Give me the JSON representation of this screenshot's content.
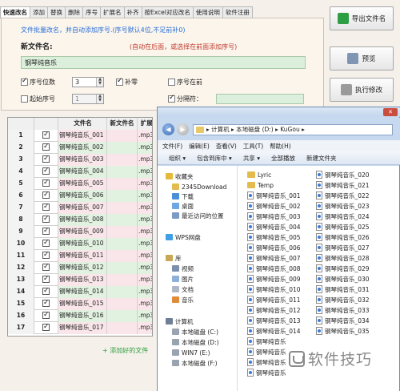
{
  "tabs": [
    "快速改名",
    "添加",
    "替换",
    "删除",
    "序号",
    "扩展名",
    "补齐",
    "按Excel对应改名",
    "使用说明",
    "软件注册"
  ],
  "form": {
    "hint": "文件批量改名，并自动添加序号.(序号默认4位,不足前补0)",
    "new_name_label": "新文件名:",
    "new_name_hint": "(自动在后面，或选择在前面添加序号)",
    "new_name_value": "钢琴纯音乐",
    "seq_digits_label": "序号位数",
    "seq_digits_value": "3",
    "pad_zero_label": "补零",
    "seq_front_label": "序号在前",
    "start_seq_label": "起始序号",
    "start_seq_value": "1",
    "separator_label": "分隔符："
  },
  "buttons": {
    "export": "导出文件名",
    "preview": "预览",
    "execute": "执行修改"
  },
  "table": {
    "headers": [
      "",
      "",
      "文件名",
      "新文件名",
      "扩展名"
    ],
    "rows": [
      {
        "num": "1",
        "name": "钢琴纯音乐_001",
        "ext": ".mp3"
      },
      {
        "num": "2",
        "name": "钢琴纯音乐_002",
        "ext": ".mp3"
      },
      {
        "num": "3",
        "name": "钢琴纯音乐_003",
        "ext": ".mp3"
      },
      {
        "num": "4",
        "name": "钢琴纯音乐_004",
        "ext": ".mp3"
      },
      {
        "num": "5",
        "name": "钢琴纯音乐_005",
        "ext": ".mp3"
      },
      {
        "num": "6",
        "name": "钢琴纯音乐_006",
        "ext": ".mp3"
      },
      {
        "num": "7",
        "name": "钢琴纯音乐_007",
        "ext": ".mp3"
      },
      {
        "num": "8",
        "name": "钢琴纯音乐_008",
        "ext": ".mp3"
      },
      {
        "num": "9",
        "name": "钢琴纯音乐_009",
        "ext": ".mp3"
      },
      {
        "num": "10",
        "name": "钢琴纯音乐_010",
        "ext": ".mp3"
      },
      {
        "num": "11",
        "name": "钢琴纯音乐_011",
        "ext": ".mp3"
      },
      {
        "num": "12",
        "name": "钢琴纯音乐_012",
        "ext": ".mp3"
      },
      {
        "num": "13",
        "name": "钢琴纯音乐_013",
        "ext": ".mp3"
      },
      {
        "num": "14",
        "name": "钢琴纯音乐_014",
        "ext": ".mp3"
      },
      {
        "num": "15",
        "name": "钢琴纯音乐_015",
        "ext": ".mp3"
      },
      {
        "num": "16",
        "name": "钢琴纯音乐_016",
        "ext": ".mp3"
      },
      {
        "num": "17",
        "name": "钢琴纯音乐_017",
        "ext": ".mp3"
      }
    ]
  },
  "add_link": "+ 添加好的文件",
  "explorer": {
    "address": "▸ 计算机 ▸ 本地磁盘 (D:) ▸ KuGou ▸",
    "menu": [
      "文件(F)",
      "编辑(E)",
      "查看(V)",
      "工具(T)",
      "帮助(H)"
    ],
    "toolbar": [
      "组织 ▾",
      "包含到库中 ▾",
      "共享 ▾",
      "全部播放",
      "新建文件夹"
    ],
    "nav": [
      "收藏夹",
      "2345Download",
      "下载",
      "桌面",
      "最近访问的位置",
      "WPS网盘",
      "库",
      "视频",
      "图片",
      "文档",
      "音乐",
      "计算机",
      "本地磁盘 (C:)",
      "本地磁盘 (D:)",
      "WIN7 (E:)",
      "本地磁盘 (F:)"
    ],
    "col1": [
      "Lyric",
      "Temp",
      "钢琴纯音乐_001",
      "钢琴纯音乐_002",
      "钢琴纯音乐_003",
      "钢琴纯音乐_004",
      "钢琴纯音乐_005",
      "钢琴纯音乐_006",
      "钢琴纯音乐_007",
      "钢琴纯音乐_008",
      "钢琴纯音乐_009",
      "钢琴纯音乐_010",
      "钢琴纯音乐_011",
      "钢琴纯音乐_012",
      "钢琴纯音乐_013",
      "钢琴纯音乐_014",
      "钢琴纯音乐",
      "钢琴纯音乐",
      "钢琴纯音乐",
      "钢琴纯音乐"
    ],
    "col2": [
      "钢琴纯音乐_020",
      "钢琴纯音乐_021",
      "钢琴纯音乐_022",
      "钢琴纯音乐_023",
      "钢琴纯音乐_024",
      "钢琴纯音乐_025",
      "钢琴纯音乐_026",
      "钢琴纯音乐_027",
      "钢琴纯音乐_028",
      "钢琴纯音乐_029",
      "钢琴纯音乐_030",
      "钢琴纯音乐_031",
      "钢琴纯音乐_032",
      "钢琴纯音乐_033",
      "钢琴纯音乐_034",
      "钢琴纯音乐_035"
    ]
  },
  "watermark": "软件技巧",
  "colors": {
    "accent_green": "#dcefdc",
    "accent_pink": "#fae6ea",
    "hint_blue": "#2b6fd6",
    "hint_red": "#c0392b"
  }
}
